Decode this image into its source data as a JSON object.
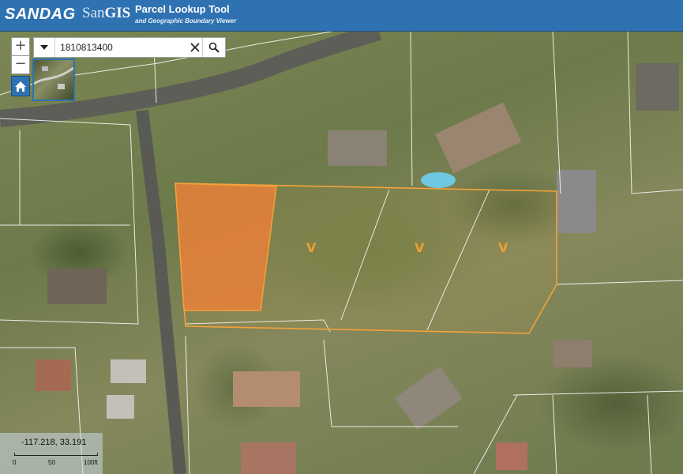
{
  "header": {
    "logo_sandag": "SANDAG",
    "logo_sangis_san": "San",
    "logo_sangis_gis": "GIS",
    "title": "Parcel Lookup Tool",
    "subtitle": "and Geographic Boundary Viewer"
  },
  "search": {
    "value": "1810813400"
  },
  "map": {
    "parcel_labels": [
      "V",
      "V",
      "V"
    ],
    "highlight_color": "#e8803a",
    "parcel_outline_color": "#f3a23a"
  },
  "coordinates": {
    "text": "-117.218, 33.191"
  },
  "scale": {
    "labels": [
      "0",
      "50",
      "100ft"
    ]
  },
  "colors": {
    "header_bg": "#2f72b1"
  }
}
